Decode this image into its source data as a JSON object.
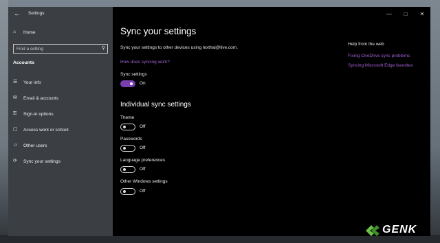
{
  "app": {
    "title": "Settings"
  },
  "sidebar": {
    "home": "Home",
    "search_placeholder": "Find a setting",
    "section": "Accounts",
    "items": [
      {
        "label": "Your info",
        "icon": "person-card-icon"
      },
      {
        "label": "Email & accounts",
        "icon": "mail-icon"
      },
      {
        "label": "Sign-in options",
        "icon": "key-icon"
      },
      {
        "label": "Access work or school",
        "icon": "briefcase-icon"
      },
      {
        "label": "Other users",
        "icon": "add-user-icon"
      },
      {
        "label": "Sync your settings",
        "icon": "sync-icon"
      }
    ]
  },
  "main": {
    "title": "Sync your settings",
    "description": "Sync your settings to other devices using lexthai@live.com.",
    "how_link": "How does syncing work?",
    "sync_label": "Sync settings",
    "sync_state": "On",
    "individual_heading": "Individual sync settings",
    "individual": [
      {
        "label": "Theme",
        "state": "Off"
      },
      {
        "label": "Passwords",
        "state": "Off"
      },
      {
        "label": "Language preferences",
        "state": "Off"
      },
      {
        "label": "Other Windows settings",
        "state": "Off"
      }
    ]
  },
  "help": {
    "title": "Help from the web",
    "links": [
      "Fixing OneDrive sync problems",
      "Syncing Microsoft Edge favorites"
    ]
  },
  "watermark": {
    "text": "GENK"
  },
  "colors": {
    "accent": "#7a3fae",
    "link": "#a05fd0",
    "sidebar": "#3b3f44"
  }
}
